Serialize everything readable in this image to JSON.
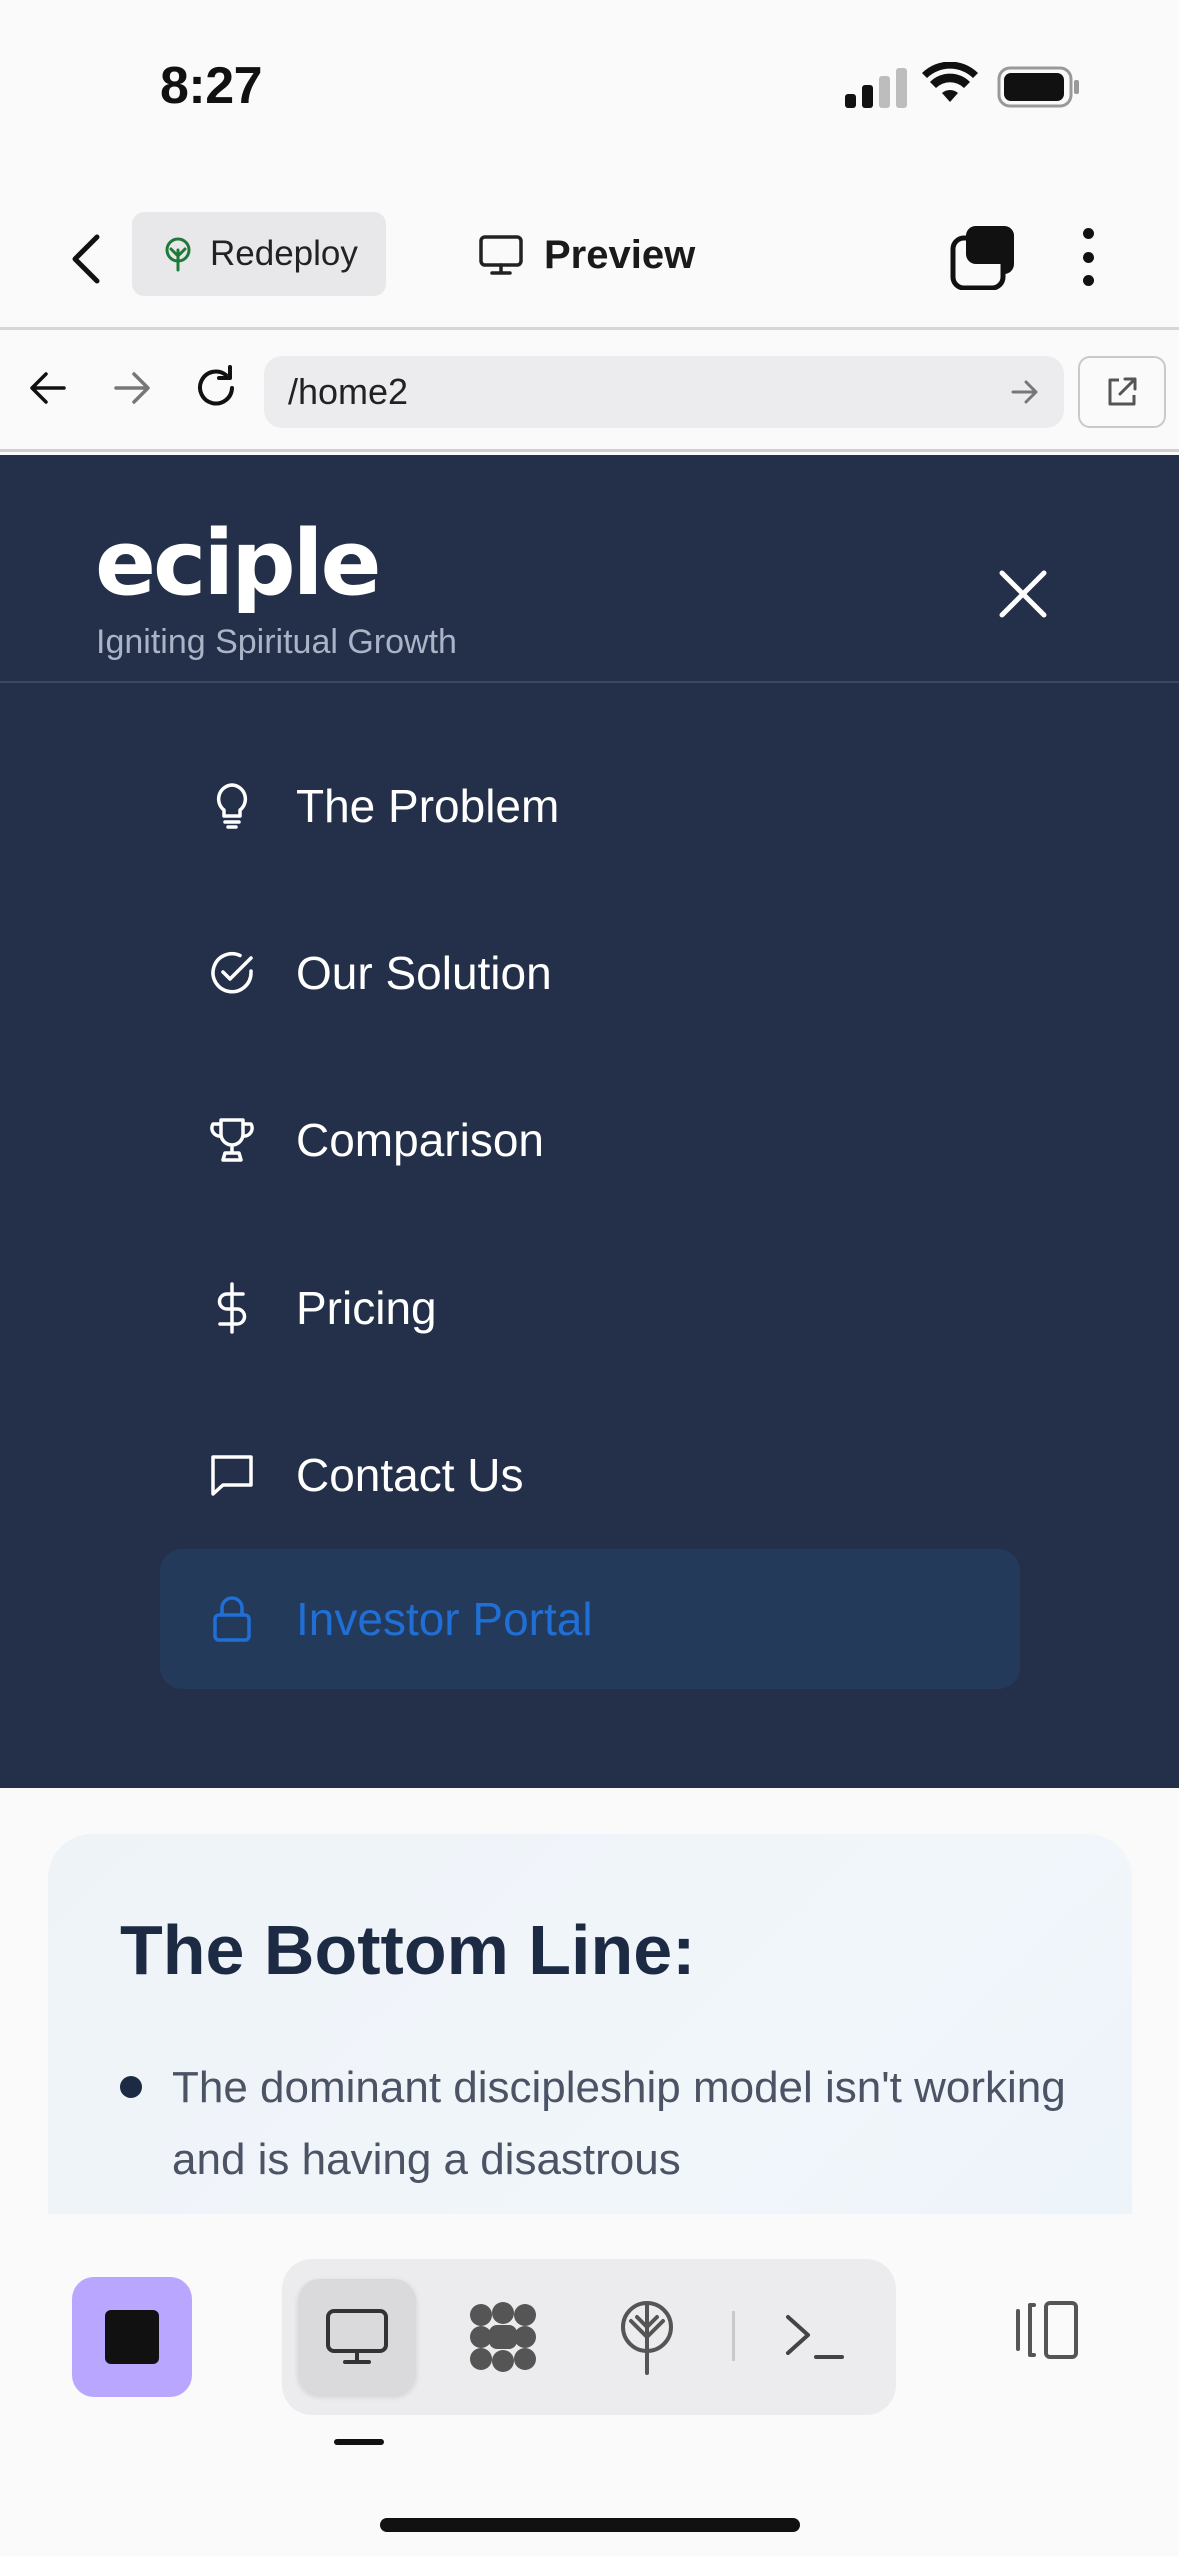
{
  "status_bar": {
    "time": "8:27"
  },
  "toolbar": {
    "redeploy_label": "Redeploy",
    "preview_label": "Preview"
  },
  "browser": {
    "url": "/home2"
  },
  "menu": {
    "logo": "eciple",
    "tagline": "Igniting Spiritual Growth",
    "items": [
      {
        "label": "The Problem",
        "icon": "lightbulb-icon"
      },
      {
        "label": "Our Solution",
        "icon": "check-circle-icon"
      },
      {
        "label": "Comparison",
        "icon": "trophy-icon"
      },
      {
        "label": "Pricing",
        "icon": "dollar-icon"
      },
      {
        "label": "Contact Us",
        "icon": "message-square-icon"
      },
      {
        "label": "Investor Portal",
        "icon": "lock-icon",
        "active": true
      }
    ],
    "colors": {
      "background": "#243049",
      "active_text": "#1f6fd6",
      "active_bg": "#243a5a"
    }
  },
  "content": {
    "heading": "The Bottom Line:",
    "bullet_1": "The dominant discipleship model isn't working and is having a disastrous"
  },
  "bottom_bar": {
    "accent": "#b8a6ff",
    "modes": [
      "monitor-icon",
      "network-icon",
      "deploy-tree-icon",
      "terminal-icon"
    ],
    "selected_mode": "monitor-icon"
  }
}
